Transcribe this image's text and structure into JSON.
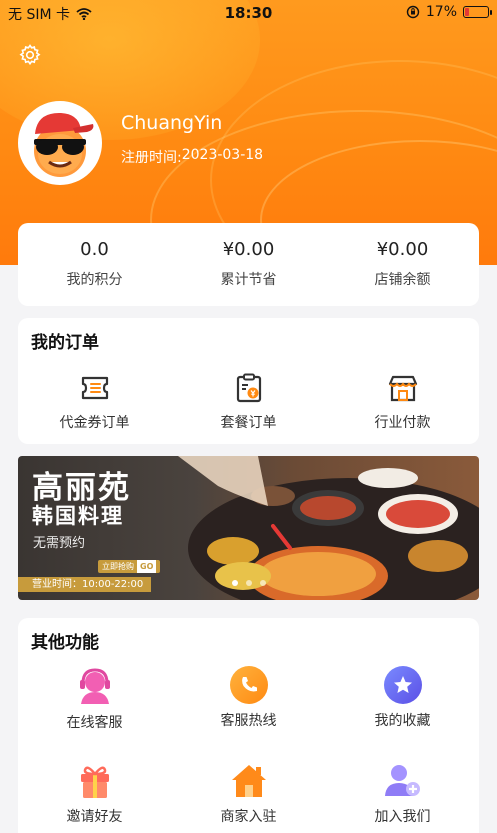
{
  "status_bar": {
    "carrier": "无 SIM 卡",
    "time": "18:30",
    "battery_percent": "17%",
    "battery_level": 0.17
  },
  "profile": {
    "username": "ChuangYin",
    "register_label": "注册时间:",
    "register_date": "2023-03-18"
  },
  "stats": [
    {
      "value": "0.0",
      "label": "我的积分"
    },
    {
      "value": "¥0.00",
      "label": "累计节省"
    },
    {
      "value": "¥0.00",
      "label": "店铺余额"
    }
  ],
  "orders": {
    "title": "我的订单",
    "items": [
      {
        "label": "代金券订单",
        "icon": "voucher-ticket-icon"
      },
      {
        "label": "套餐订单",
        "icon": "clipboard-yen-icon"
      },
      {
        "label": "行业付款",
        "icon": "storefront-icon"
      }
    ]
  },
  "banner": {
    "title": "高丽苑",
    "subtitle": "韩国料理",
    "tagline": "无需预约",
    "cta": "立即抢购",
    "cta_go": "GO",
    "hours": "营业时间：10:00-22:00"
  },
  "other": {
    "title": "其他功能",
    "items": [
      {
        "label": "在线客服",
        "icon": "headset-agent-icon",
        "color": "#f25fb3"
      },
      {
        "label": "客服热线",
        "icon": "phone-icon",
        "color": "#ff9a1e"
      },
      {
        "label": "我的收藏",
        "icon": "star-icon",
        "color": "#6a6cf5"
      },
      {
        "label": "邀请好友",
        "icon": "gift-icon",
        "color": "#ff6b5a"
      },
      {
        "label": "商家入驻",
        "icon": "home-icon",
        "color": "#ff8a1a"
      },
      {
        "label": "加入我们",
        "icon": "add-user-icon",
        "color": "#8f7cf6"
      }
    ]
  },
  "colors": {
    "header_orange": "#ff8a12",
    "accent_gold": "#c79b3c"
  }
}
